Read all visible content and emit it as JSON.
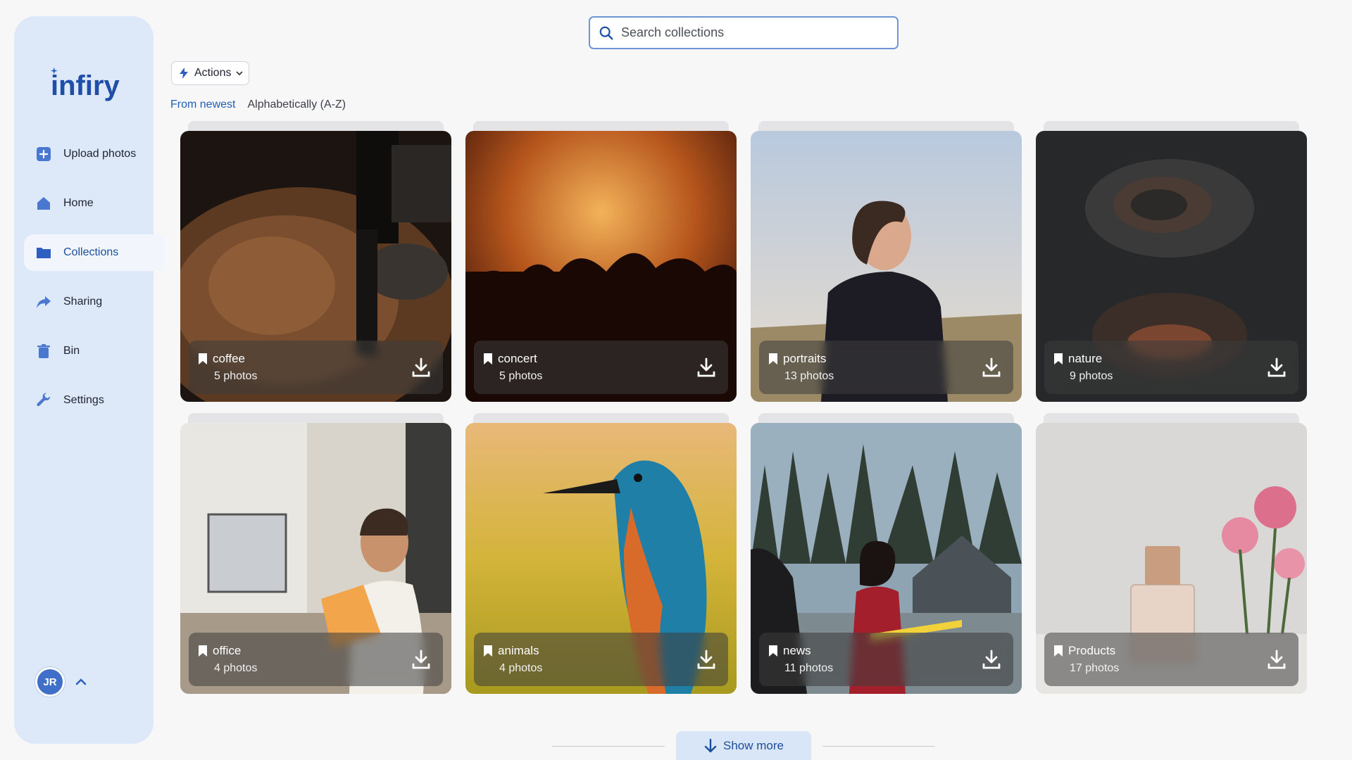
{
  "app": {
    "logo_text": "infiry"
  },
  "sidebar": {
    "items": [
      {
        "label": "Upload photos",
        "icon": "plus-square-icon"
      },
      {
        "label": "Home",
        "icon": "home-icon"
      },
      {
        "label": "Collections",
        "icon": "folder-icon",
        "active": true
      },
      {
        "label": "Sharing",
        "icon": "share-arrow-icon"
      },
      {
        "label": "Bin",
        "icon": "trash-icon"
      },
      {
        "label": "Settings",
        "icon": "wrench-icon"
      }
    ],
    "user_initials": "JR"
  },
  "search": {
    "placeholder": "Search collections"
  },
  "toolbar": {
    "actions_label": "Actions"
  },
  "sort": {
    "options": [
      "From newest",
      "Alphabetically (A-Z)"
    ],
    "active_index": 0
  },
  "collections": [
    {
      "name": "coffee",
      "count": "5 photos"
    },
    {
      "name": "concert",
      "count": "5 photos"
    },
    {
      "name": "portraits",
      "count": "13 photos"
    },
    {
      "name": "nature",
      "count": "9 photos"
    },
    {
      "name": "office",
      "count": "4 photos"
    },
    {
      "name": "animals",
      "count": "4 photos"
    },
    {
      "name": "news",
      "count": "11 photos"
    },
    {
      "name": "Products",
      "count": "17 photos"
    }
  ],
  "footer": {
    "show_more_label": "Show more"
  },
  "colors": {
    "accent": "#1f5fb6",
    "sidebar_bg": "#dde9f8",
    "avatar_bg": "#3f6fc9"
  }
}
